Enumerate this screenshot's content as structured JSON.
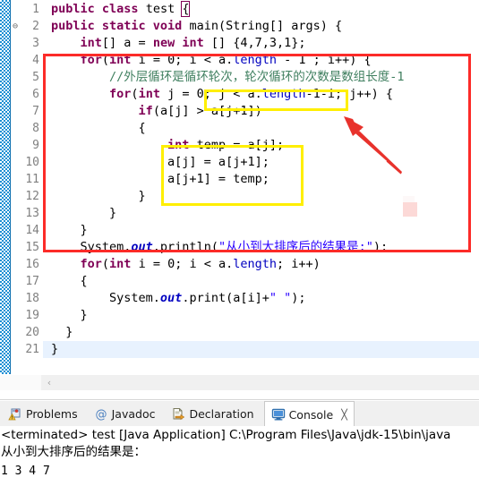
{
  "editor": {
    "lines": [
      {
        "num": "1",
        "fold": "",
        "current": false,
        "tokens": [
          {
            "t": "public ",
            "c": "kw"
          },
          {
            "t": "class ",
            "c": "kw"
          },
          {
            "t": "test ",
            "c": "plain"
          },
          {
            "t": "{",
            "c": "plain bracketbox"
          }
        ]
      },
      {
        "num": "2",
        "fold": "⊖",
        "current": false,
        "tokens": [
          {
            "t": "public static void ",
            "c": "kw"
          },
          {
            "t": "main(String[] args) {",
            "c": "plain"
          }
        ]
      },
      {
        "num": "3",
        "fold": "",
        "current": false,
        "tokens": [
          {
            "t": "    ",
            "c": "plain"
          },
          {
            "t": "int",
            "c": "kw"
          },
          {
            "t": "[] a = ",
            "c": "plain"
          },
          {
            "t": "new int ",
            "c": "kw"
          },
          {
            "t": "[] {4,7,3,1};",
            "c": "plain"
          }
        ]
      },
      {
        "num": "4",
        "fold": "",
        "current": false,
        "tokens": [
          {
            "t": "    ",
            "c": "plain"
          },
          {
            "t": "for",
            "c": "kw"
          },
          {
            "t": "(",
            "c": "plain"
          },
          {
            "t": "int",
            "c": "kw"
          },
          {
            "t": " i = 0; i < a.",
            "c": "plain"
          },
          {
            "t": "length",
            "c": "fld"
          },
          {
            "t": " - 1 ; i++) {",
            "c": "plain"
          }
        ]
      },
      {
        "num": "5",
        "fold": "",
        "current": false,
        "tokens": [
          {
            "t": "        //外层循环是循环轮次，轮次循环的次数是数组长度-1",
            "c": "cmt"
          }
        ]
      },
      {
        "num": "6",
        "fold": "",
        "current": false,
        "tokens": [
          {
            "t": "        ",
            "c": "plain"
          },
          {
            "t": "for",
            "c": "kw"
          },
          {
            "t": "(",
            "c": "plain"
          },
          {
            "t": "int",
            "c": "kw"
          },
          {
            "t": " j = 0; j < a.",
            "c": "plain"
          },
          {
            "t": "length",
            "c": "fld"
          },
          {
            "t": "-1-i; j++) {",
            "c": "plain"
          }
        ]
      },
      {
        "num": "7",
        "fold": "",
        "current": false,
        "tokens": [
          {
            "t": "            ",
            "c": "plain"
          },
          {
            "t": "if",
            "c": "kw"
          },
          {
            "t": "(a[j] > a[j+1])",
            "c": "plain"
          }
        ]
      },
      {
        "num": "8",
        "fold": "",
        "current": false,
        "tokens": [
          {
            "t": "            {",
            "c": "plain"
          }
        ]
      },
      {
        "num": "9",
        "fold": "",
        "current": false,
        "tokens": [
          {
            "t": "                ",
            "c": "plain"
          },
          {
            "t": "int",
            "c": "kw"
          },
          {
            "t": " temp = a[j];",
            "c": "plain"
          }
        ]
      },
      {
        "num": "10",
        "fold": "",
        "current": false,
        "tokens": [
          {
            "t": "                a[j] = a[j+1];",
            "c": "plain"
          }
        ]
      },
      {
        "num": "11",
        "fold": "",
        "current": false,
        "tokens": [
          {
            "t": "                a[j+1] = temp;",
            "c": "plain"
          }
        ]
      },
      {
        "num": "12",
        "fold": "",
        "current": false,
        "tokens": [
          {
            "t": "            }",
            "c": "plain"
          }
        ]
      },
      {
        "num": "13",
        "fold": "",
        "current": false,
        "tokens": [
          {
            "t": "        }",
            "c": "plain"
          }
        ]
      },
      {
        "num": "14",
        "fold": "",
        "current": false,
        "tokens": [
          {
            "t": "    }",
            "c": "plain"
          }
        ]
      },
      {
        "num": "15",
        "fold": "",
        "current": false,
        "tokens": [
          {
            "t": "    System.",
            "c": "plain"
          },
          {
            "t": "out",
            "c": "stat"
          },
          {
            "t": ".println(",
            "c": "plain"
          },
          {
            "t": "\"从小到大排序后的结果是:\"",
            "c": "str"
          },
          {
            "t": ");",
            "c": "plain"
          }
        ]
      },
      {
        "num": "16",
        "fold": "",
        "current": false,
        "tokens": [
          {
            "t": "    ",
            "c": "plain"
          },
          {
            "t": "for",
            "c": "kw"
          },
          {
            "t": "(",
            "c": "plain"
          },
          {
            "t": "int",
            "c": "kw"
          },
          {
            "t": " i = 0; i < a.",
            "c": "plain"
          },
          {
            "t": "length",
            "c": "fld"
          },
          {
            "t": "; i++)",
            "c": "plain"
          }
        ]
      },
      {
        "num": "17",
        "fold": "",
        "current": false,
        "tokens": [
          {
            "t": "    {",
            "c": "plain"
          }
        ]
      },
      {
        "num": "18",
        "fold": "",
        "current": false,
        "tokens": [
          {
            "t": "        System.",
            "c": "plain"
          },
          {
            "t": "out",
            "c": "stat"
          },
          {
            "t": ".print(a[i]+",
            "c": "plain"
          },
          {
            "t": "\" \"",
            "c": "str"
          },
          {
            "t": ");",
            "c": "plain"
          }
        ]
      },
      {
        "num": "19",
        "fold": "",
        "current": false,
        "tokens": [
          {
            "t": "    }",
            "c": "plain"
          }
        ]
      },
      {
        "num": "20",
        "fold": "",
        "current": false,
        "tokens": [
          {
            "t": "  }",
            "c": "plain"
          }
        ]
      },
      {
        "num": "21",
        "fold": "",
        "current": true,
        "tokens": [
          {
            "t": "}",
            "c": "plain"
          }
        ]
      }
    ],
    "annotations": {
      "red_box_color": "#fc2b28",
      "yellow_box_color": "#ffef00",
      "arrow_color": "#e8322c",
      "pink_square_color": "#fcd9d7",
      "current_line_color": "#e8f2fe",
      "annotation_strip_color": "#1a8fd4"
    },
    "scrollbar": {
      "left_arrow_glyph": "‹"
    }
  },
  "bottom_panel": {
    "tabs": [
      {
        "label": "Problems",
        "icon": "problems-icon",
        "active": false,
        "closable": false
      },
      {
        "label": "Javadoc",
        "icon": "javadoc-icon",
        "active": false,
        "closable": false
      },
      {
        "label": "Declaration",
        "icon": "declaration-icon",
        "active": false,
        "closable": false
      },
      {
        "label": "Console",
        "icon": "console-icon",
        "active": true,
        "closable": true,
        "close_glyph": "╳"
      }
    ],
    "console": {
      "status_line": "<terminated> test [Java Application] C:\\Program Files\\Java\\jdk-15\\bin\\java",
      "output_lines": [
        "从小到大排序后的结果是：",
        "1 3 4 7"
      ]
    }
  }
}
